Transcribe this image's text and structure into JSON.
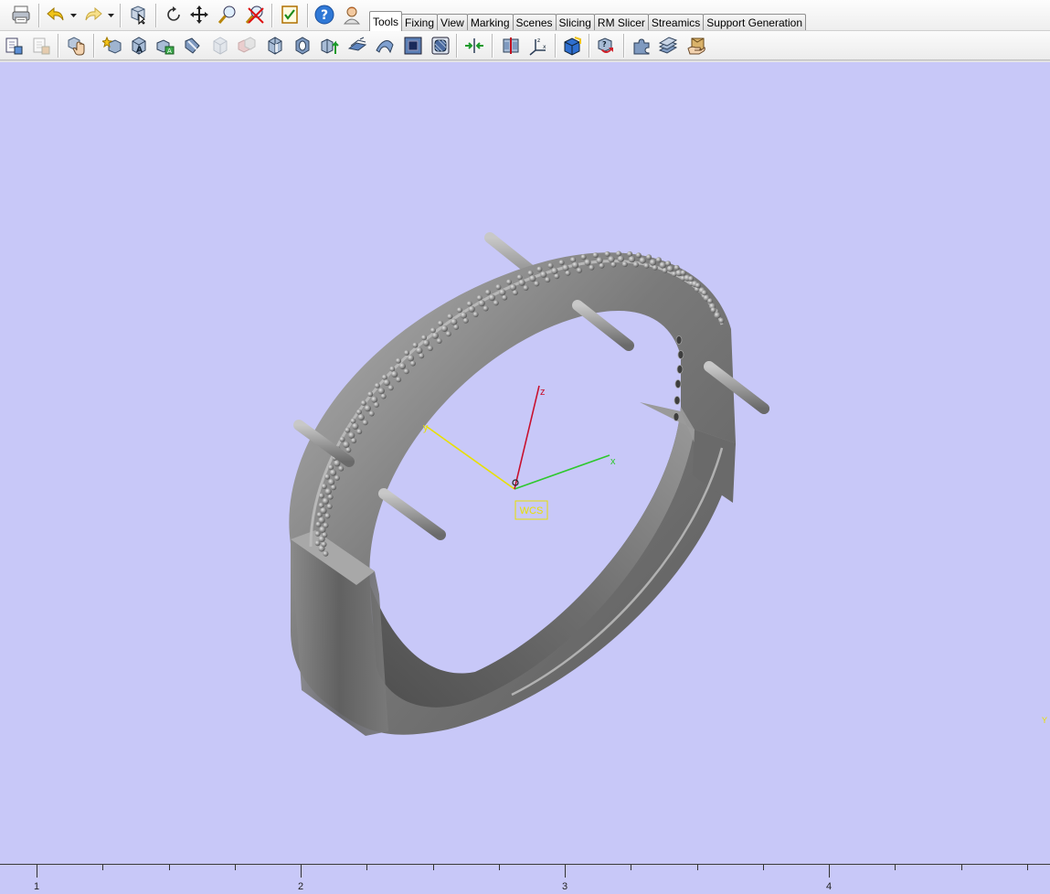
{
  "toolbar": {
    "row1_icons": [
      "print-icon",
      "undo-icon",
      "redo-icon",
      "part-select-icon",
      "rotate-view-icon",
      "pan-icon",
      "zoom-icon",
      "zoom-fit-icon",
      "check-list-icon",
      "help-icon",
      "user-assistant-icon"
    ],
    "row2_icons": [
      "import-part-icon",
      "export-part-icon",
      "pick-part-icon",
      "add-primitive-icon",
      "cube-view-icon",
      "translate-part-icon",
      "wrench-fix-icon",
      "hollow-icon",
      "duplicate-icon",
      "cut-icon",
      "extrude-icon",
      "boolean-up-icon",
      "surface-icon",
      "smooth-icon",
      "shell-icon",
      "offset-icon",
      "mirror-icon",
      "scale-icon",
      "axes-icon",
      "box-icon",
      "repair-icon",
      "puzzle-icon",
      "stack-icon",
      "hand-package-icon"
    ]
  },
  "tabs": [
    {
      "label": "Tools",
      "active": true
    },
    {
      "label": "Fixing",
      "active": false
    },
    {
      "label": "View",
      "active": false
    },
    {
      "label": "Marking",
      "active": false
    },
    {
      "label": "Scenes",
      "active": false
    },
    {
      "label": "Slicing",
      "active": false
    },
    {
      "label": "RM Slicer",
      "active": false
    },
    {
      "label": "Streamics",
      "active": false
    },
    {
      "label": "Support Generation",
      "active": false
    }
  ],
  "viewport": {
    "background_color": "#c8c8f8",
    "part_color": "#8e8e8e",
    "axes": {
      "x_label": "x",
      "y_label": "y",
      "z_label": "z",
      "x_color": "#2ec82e",
      "y_color": "#e8e000",
      "z_color": "#c8102e",
      "wcs_label": "WCS"
    },
    "corner_marker": "Y"
  },
  "ruler": {
    "labels": [
      "1",
      "2",
      "3",
      "4"
    ]
  }
}
